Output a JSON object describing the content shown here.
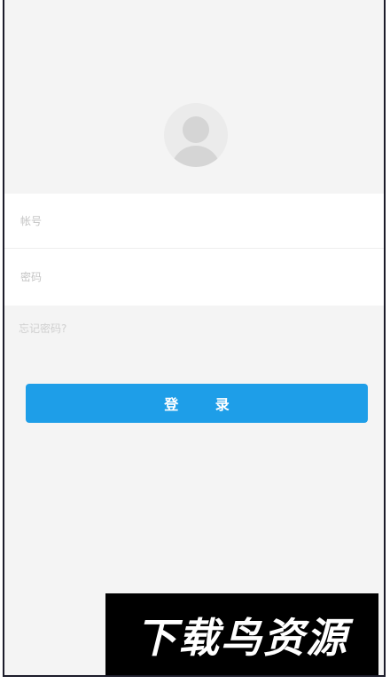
{
  "login": {
    "account_placeholder": "帐号",
    "password_placeholder": "密码",
    "forgot_password": "忘记密码?",
    "login_button": "登 录"
  },
  "avatar": {
    "icon": "user-avatar-icon"
  },
  "watermark": {
    "text": "下载鸟资源"
  },
  "colors": {
    "background": "#f4f4f4",
    "accent": "#1e9ee8",
    "form_background": "#ffffff",
    "frame_border": "#1c1c2a"
  }
}
